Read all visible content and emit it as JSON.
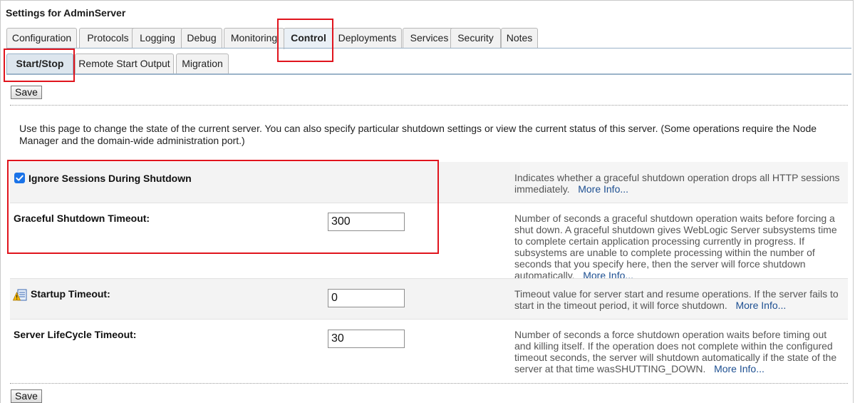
{
  "window": {
    "title": "Settings for AdminServer"
  },
  "tabs": [
    {
      "label": "Configuration",
      "active": false
    },
    {
      "label": "Protocols",
      "active": false
    },
    {
      "label": "Logging",
      "active": false
    },
    {
      "label": "Debug",
      "active": false
    },
    {
      "label": "Monitoring",
      "active": false
    },
    {
      "label": "Control",
      "active": true
    },
    {
      "label": "Deployments",
      "active": false
    },
    {
      "label": "Services",
      "active": false
    },
    {
      "label": "Security",
      "active": false
    },
    {
      "label": "Notes",
      "active": false
    }
  ],
  "subtabs": [
    {
      "label": "Start/Stop",
      "active": true
    },
    {
      "label": "Remote Start Output",
      "active": false
    },
    {
      "label": "Migration",
      "active": false
    }
  ],
  "toolbar": {
    "save_label": "Save"
  },
  "intro": "Use this page to change the state of the current server. You can also specify particular shutdown settings or view the current status of this server. (Some operations require the Node Manager and the domain-wide administration port.)",
  "settings": {
    "ignore_sessions": {
      "label": "Ignore Sessions During Shutdown",
      "checked": true,
      "help": "Indicates whether a graceful shutdown operation drops all HTTP sessions immediately.",
      "more": "More Info..."
    },
    "graceful_timeout": {
      "label": "Graceful Shutdown Timeout:",
      "value": "300",
      "help": "Number of seconds a graceful shutdown operation waits before forcing a shut down. A graceful shutdown gives WebLogic Server subsystems time to complete certain application processing currently in progress. If subsystems are unable to complete processing within the number of seconds that you specify here, then the server will force shutdown automatically.",
      "more": "More Info..."
    },
    "startup_timeout": {
      "label": "Startup Timeout:",
      "value": "0",
      "icon": "restart-required-warning-icon",
      "help": "Timeout value for server start and resume operations. If the server fails to start in the timeout period, it will force shutdown.",
      "more": "More Info..."
    },
    "lifecycle_timeout": {
      "label": "Server LifeCycle Timeout:",
      "value": "30",
      "help": "Number of seconds a force shutdown operation waits before timing out and killing itself. If the operation does not complete within the configured timeout seconds, the server will shutdown automatically if the state of the server at that time wasSHUTTING_DOWN.",
      "more": "More Info..."
    }
  },
  "colors": {
    "highlight": "#e0141d",
    "accent": "#1a73e8",
    "link": "#1d4f91"
  }
}
